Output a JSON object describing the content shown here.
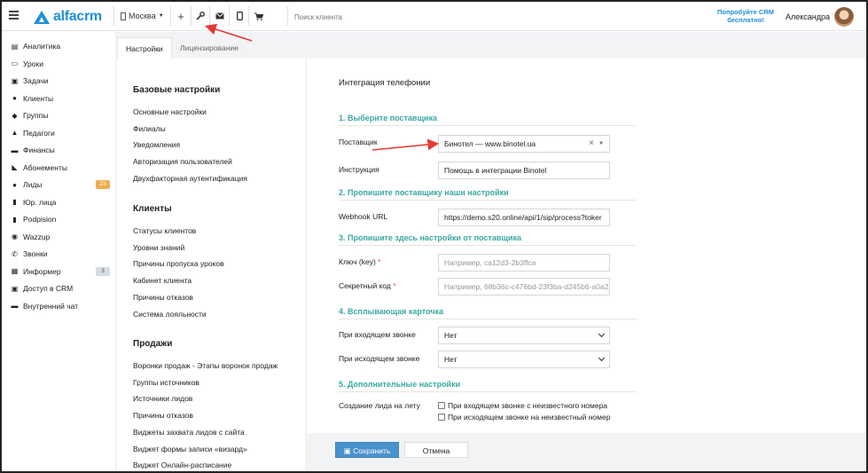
{
  "header": {
    "logo_text": "alfacrm",
    "city": "Москва",
    "search_placeholder": "Поиск клиента",
    "promo": "Попробуйте CRM бесплатно!",
    "user_name": "Александра",
    "toolbar_icons": [
      "plus-icon",
      "wrench-icon",
      "envelope-icon",
      "mobile-icon",
      "cart-icon"
    ]
  },
  "sidebar": {
    "items": [
      {
        "label": "Аналитика",
        "icon": "analytics-icon",
        "glyph": "▤"
      },
      {
        "label": "Уроки",
        "icon": "calendar-icon",
        "glyph": "▭"
      },
      {
        "label": "Задачи",
        "icon": "tasks-icon",
        "glyph": "▣"
      },
      {
        "label": "Клиенты",
        "icon": "user-icon",
        "glyph": "●"
      },
      {
        "label": "Группы",
        "icon": "users-icon",
        "glyph": "◆"
      },
      {
        "label": "Педагоги",
        "icon": "graduation-icon",
        "glyph": "▲"
      },
      {
        "label": "Финансы",
        "icon": "money-icon",
        "glyph": "▬"
      },
      {
        "label": "Абонементы",
        "icon": "tag-icon",
        "glyph": "◣"
      },
      {
        "label": "Лиды",
        "icon": "user-plus-icon",
        "glyph": "●",
        "badge": "23",
        "badge_color": "orange"
      },
      {
        "label": "Юр. лица",
        "icon": "building-icon",
        "glyph": "▮"
      },
      {
        "label": "Podpision",
        "icon": "file-icon",
        "glyph": "▮"
      },
      {
        "label": "Wazzup",
        "icon": "whatsapp-icon",
        "glyph": "◉"
      },
      {
        "label": "Звонки",
        "icon": "phone-icon",
        "glyph": "✆"
      },
      {
        "label": "Информер",
        "icon": "list-icon",
        "glyph": "▦",
        "badge": "3",
        "badge_color": "gray"
      },
      {
        "label": "Доступ в CRM",
        "icon": "lock-icon",
        "glyph": "▣"
      },
      {
        "label": "Внутренний чат",
        "icon": "chat-icon",
        "glyph": "▬"
      }
    ]
  },
  "tabs": [
    {
      "label": "Настройки",
      "active": true
    },
    {
      "label": "Лицензирование",
      "active": false
    }
  ],
  "settings_menu": {
    "base": {
      "title": "Базовые настройки",
      "links": [
        "Основные настройки",
        "Филиалы",
        "Уведомления",
        "Авторизация пользователей",
        "Двухфакторная аутентификация"
      ]
    },
    "clients": {
      "title": "Клиенты",
      "links": [
        "Статусы клиентов",
        "Уровни знаний",
        "Причины пропуска уроков",
        "Кабинет клиента",
        "Причины отказов",
        "Система лояльности"
      ]
    },
    "sales": {
      "title": "Продажи",
      "links": [
        "Воронки продаж - Этапы воронок продаж",
        "Группы источников",
        "Источники лидов",
        "Причины отказов",
        "Виджеты захвата лидов с сайта",
        "Виджет формы записи «визард»",
        "Виджет Онлайн-расписание"
      ]
    }
  },
  "panel": {
    "title": "Интеграция телефонии",
    "sections": {
      "s1": "1. Выберите поставщика",
      "s2": "2. Пропишите поставщику наши настройки",
      "s3": "3. Пропишите здесь настройки от поставщика",
      "s4": "4. Всплывающая карточка",
      "s5": "5. Дополнительные настройки"
    },
    "provider": {
      "label": "Поставщик",
      "value": "Бинотел — www.binotel.ua"
    },
    "instruction": {
      "label": "Инструкция",
      "value": "Помощь в интеграции Binotel"
    },
    "webhook": {
      "label": "Webhook URL",
      "value": "https://demo.s20.online/api/1/sip/process?toker"
    },
    "key": {
      "label": "Ключ (key)",
      "placeholder": "Например, ca12d3-2b3ffca"
    },
    "secret": {
      "label": "Секретный код",
      "placeholder": "Например, 68b36c-c476bd-23f3ba-d245b6-a0a2"
    },
    "incoming": {
      "label": "При входящем звонке",
      "value": "Нет"
    },
    "outgoing": {
      "label": "При исходящем звонке",
      "value": "Нет"
    },
    "lead_create": {
      "label": "Создание лида на лету",
      "options": [
        {
          "label": "При входящем звонке с неизвестного номера",
          "checked": false
        },
        {
          "label": "При исходящем звонке на неизвестный номер",
          "checked": false
        }
      ]
    }
  },
  "footer": {
    "save_label": "Сохранить",
    "cancel_label": "Отмена"
  },
  "colors": {
    "brand": "#1f8fd9",
    "section_title": "#3aa7a1",
    "save_button": "#4a92cc",
    "annotation_arrow": "#e53935"
  }
}
